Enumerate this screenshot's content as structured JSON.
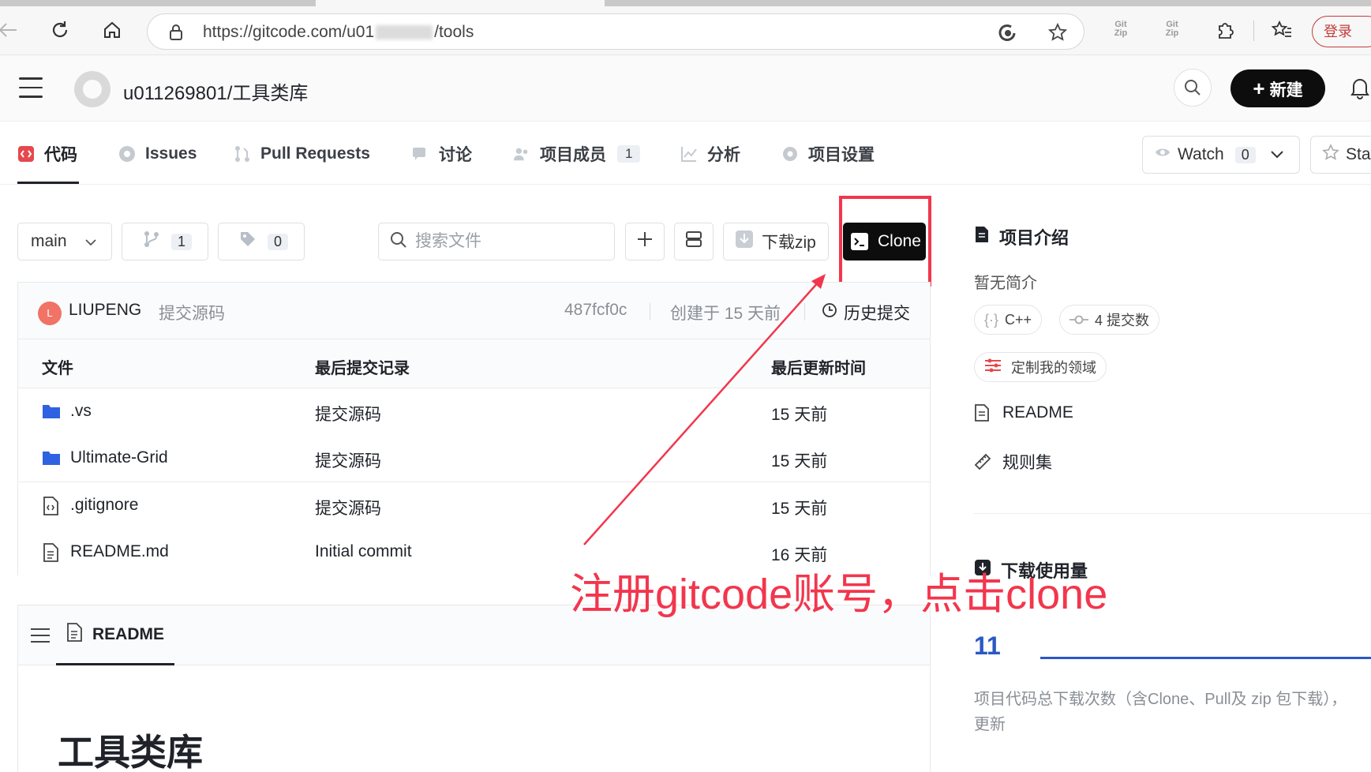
{
  "browser": {
    "url_prefix": "https://gitcode.com/u01",
    "url_suffix": "/tools",
    "login_label": "登录",
    "ext1_label": "Git Zip",
    "ext2_label": "Git Zip"
  },
  "header": {
    "repo_title": "u011269801/工具类库",
    "new_label": "新建"
  },
  "tabs": [
    {
      "label": "代码",
      "count": null
    },
    {
      "label": "Issues",
      "count": null
    },
    {
      "label": "Pull Requests",
      "count": null
    },
    {
      "label": "讨论",
      "count": null
    },
    {
      "label": "项目成员",
      "count": "1"
    },
    {
      "label": "分析",
      "count": null
    },
    {
      "label": "项目设置",
      "count": null
    }
  ],
  "watch": {
    "label": "Watch",
    "count": "0"
  },
  "star": {
    "label": "Sta"
  },
  "toolbar": {
    "branch": "main",
    "branches_count": "1",
    "tags_count": "0",
    "search_placeholder": "搜索文件",
    "download_label": "下载zip",
    "clone_label": "Clone"
  },
  "commit": {
    "avatar_letter": "L",
    "author": "LIUPENG",
    "message": "提交源码",
    "hash": "487fcf0c",
    "created": "创建于 15 天前",
    "history_label": "历史提交"
  },
  "file_table": {
    "headers": [
      "文件",
      "最后提交记录",
      "最后更新时间"
    ],
    "rows": [
      {
        "name": ".vs",
        "type": "folder",
        "commit": "提交源码",
        "time": "15 天前"
      },
      {
        "name": "Ultimate-Grid",
        "type": "folder",
        "commit": "提交源码",
        "time": "15 天前"
      },
      {
        "name": ".gitignore",
        "type": "file-code",
        "commit": "提交源码",
        "time": "15 天前"
      },
      {
        "name": "README.md",
        "type": "file-doc",
        "commit": "Initial commit",
        "time": "16 天前"
      }
    ]
  },
  "readme": {
    "tab_label": "README",
    "heading": "工具类库"
  },
  "sidebar": {
    "intro_title": "项目介绍",
    "intro_text": "暂无简介",
    "language": "C++",
    "commits": "4 提交数",
    "custom_domain": "定制我的领域",
    "readme_link": "README",
    "rules_link": "规则集",
    "download_title": "下载使用量",
    "download_count": "11",
    "download_desc": "项目代码总下载次数（含Clone、Pull及 zip 包下载），",
    "download_desc2": "更新"
  },
  "annotation": {
    "text": "注册gitcode账号，点击clone",
    "color": "#f2364d"
  },
  "colors": {
    "accent_dark": "#0d0d0d",
    "link_blue": "#2b59c3",
    "folder_blue": "#2f62e0",
    "annotation_red": "#f2364d"
  }
}
